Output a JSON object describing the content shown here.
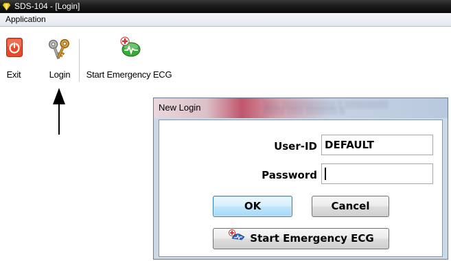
{
  "window": {
    "title": "SDS-104 - [Login]"
  },
  "menu": {
    "application_label": "Application"
  },
  "toolbar": {
    "exit_label": "Exit",
    "login_label": "Login",
    "emergency_label": "Start Emergency ECG"
  },
  "dialog": {
    "title": "New Login",
    "userid_label": "User-ID",
    "userid_value": "DEFAULT",
    "password_label": "Password",
    "password_value": "",
    "ok_label": "OK",
    "cancel_label": "Cancel",
    "emergency_button_label": "Start Emergency ECG"
  },
  "colors": {
    "titlebar": "#1b1b1b",
    "exit_red": "#e8482c",
    "ok_button": "#bee6fd",
    "emergency_green": "#3aa83a"
  }
}
